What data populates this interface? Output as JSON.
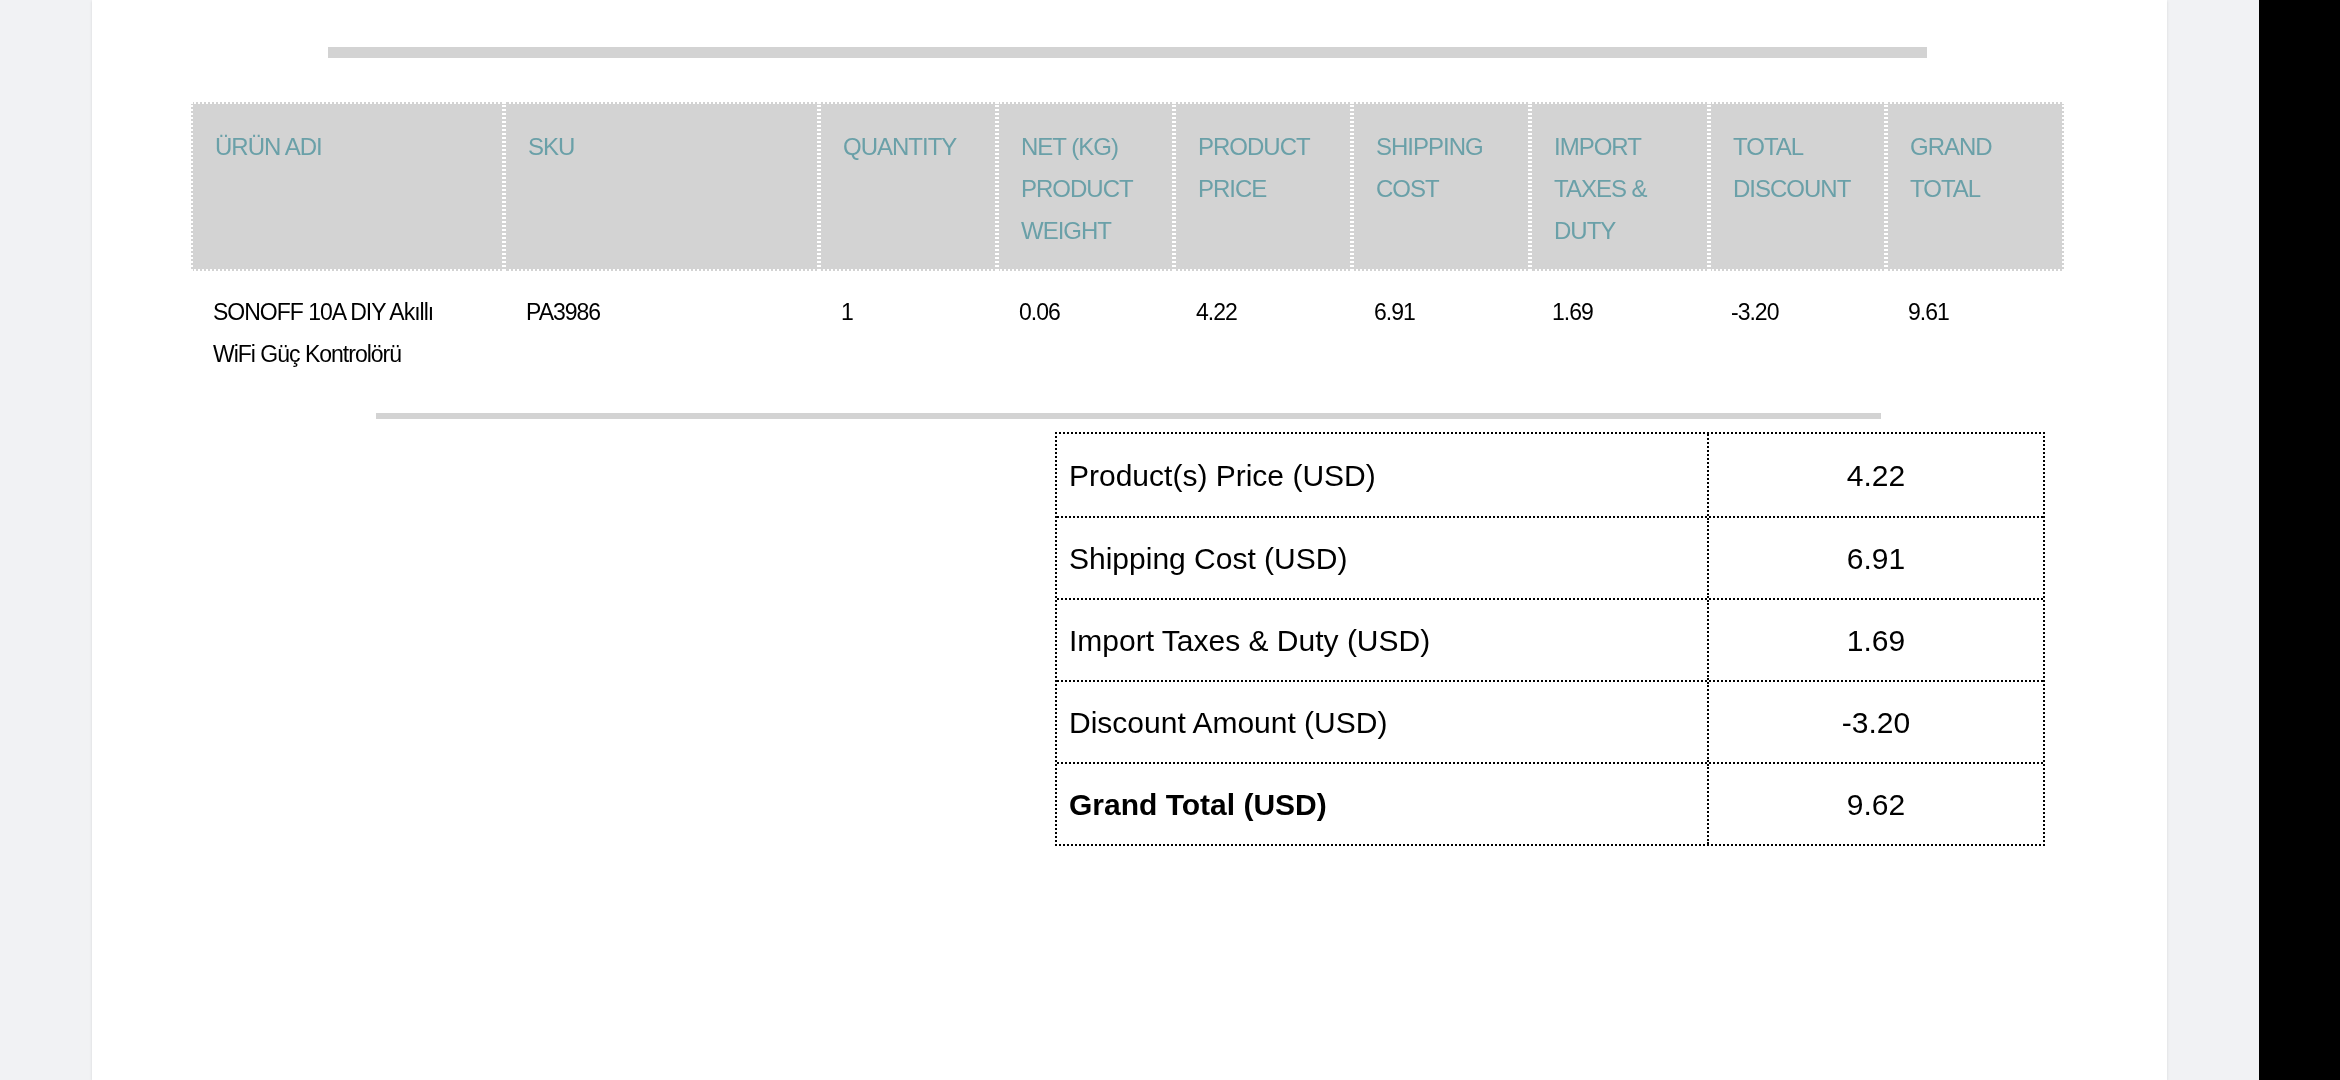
{
  "items_table": {
    "columns": [
      "ÜRÜN ADI",
      "SKU",
      "QUANTITY",
      "NET (KG) PRODUCT WEIGHT",
      "PRODUCT PRICE",
      "SHIPPING COST",
      "IMPORT TAXES & DUTY",
      "TOTAL DISCOUNT",
      "GRAND TOTAL"
    ],
    "rows": [
      [
        "SONOFF 10A DIY Akıllı WiFi Güç Kontrolörü",
        "PA3986",
        "1",
        "0.06",
        "4.22",
        "6.91",
        "1.69",
        "-3.20",
        "9.61"
      ]
    ]
  },
  "summary": [
    {
      "label": "Product(s) Price (USD)",
      "value": "4.22",
      "kind": "line"
    },
    {
      "label": "Shipping Cost (USD)",
      "value": "6.91",
      "kind": "line"
    },
    {
      "label": "Import Taxes & Duty (USD)",
      "value": "1.69",
      "kind": "line"
    },
    {
      "label": "Discount Amount (USD)",
      "value": "-3.20",
      "kind": "line"
    },
    {
      "label": "Grand Total (USD)",
      "value": "9.62",
      "kind": "total"
    }
  ]
}
